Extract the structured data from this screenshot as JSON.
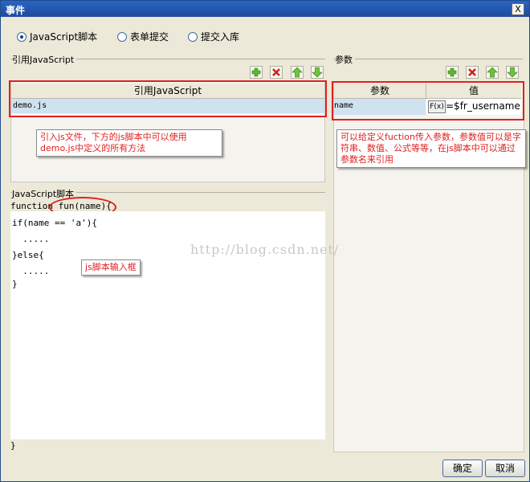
{
  "window": {
    "title": "事件",
    "close_symbol": "X"
  },
  "radios": [
    {
      "label": "JavaScript脚本",
      "selected": true
    },
    {
      "label": "表单提交",
      "selected": false
    },
    {
      "label": "提交入库",
      "selected": false
    }
  ],
  "js_ref": {
    "group_label": "引用JavaScript",
    "column": "引用JavaScript",
    "row": "demo.js",
    "note": "引入js文件，下方的js脚本中可以使用demo.js中定义的所有方法"
  },
  "params": {
    "group_label": "参数",
    "col_param": "参数",
    "col_value": "值",
    "row_name": "name",
    "row_fx": "F(x)",
    "row_value": "=$fr_username",
    "note": "可以给定义fuction传入参数，参数值可以是字符串、数值、公式等等，在js脚本中可以通过参数名来引用"
  },
  "script": {
    "group_label": "JavaScript脚本",
    "signature_prefix": "function ",
    "signature_name": "fun",
    "signature_args": "(name){",
    "lines": [
      "if(name == 'a'){",
      "  .....",
      "}else{",
      "  .....",
      "}"
    ],
    "closing": "}",
    "note": "js脚本输入框",
    "watermark": "http://blog.csdn.net/"
  },
  "footer": {
    "ok": "确定",
    "cancel": "取消"
  },
  "colors": {
    "accent_red": "#e02020",
    "title_blue": "#1f4c9c"
  }
}
